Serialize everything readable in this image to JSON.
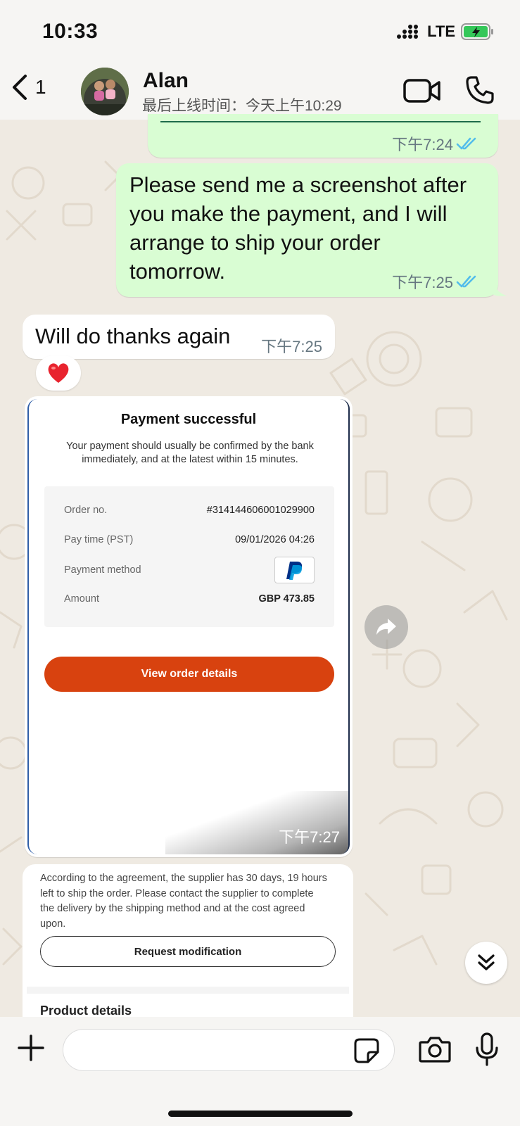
{
  "status_bar": {
    "time": "10:33",
    "network": "LTE"
  },
  "header": {
    "back_count": "1",
    "contact_name": "Alan",
    "last_seen": "最后上线时间：今天上午10:29"
  },
  "messages": [
    {
      "direction": "out",
      "time": "下午7:24",
      "read": true
    },
    {
      "direction": "out",
      "text": "Please send me a screenshot after you make the payment, and I will arrange to ship your order tomorrow.",
      "time": "下午7:25",
      "read": true
    },
    {
      "direction": "in",
      "text": "Will do thanks again",
      "time": "下午7:25",
      "reaction": "❤️"
    }
  ],
  "payment_card": {
    "title": "Payment successful",
    "description": "Your payment should usually be confirmed by the bank immediately, and at the latest within 15 minutes.",
    "rows": [
      {
        "label": "Order no.",
        "value": "#314144606001029900"
      },
      {
        "label": "Pay time (PST)",
        "value": "09/01/2026 04:26"
      },
      {
        "label": "Payment method",
        "value": ""
      },
      {
        "label": "Amount",
        "value": "GBP 473.85"
      }
    ],
    "button_label": "View order details",
    "time": "下午7:27"
  },
  "card2": {
    "text": "According to the agreement, the supplier has 30 days, 19 hours left to ship the order. Please contact the supplier to complete the delivery by the shipping method and at the cost agreed upon.",
    "button_label": "Request modification",
    "section_title": "Product details"
  },
  "colors": {
    "outgoing_bubble": "#d9fdd3",
    "incoming_bubble": "#ffffff",
    "read_ticks": "#53bdeb",
    "primary_button": "#d8420f",
    "chat_background": "#efeae2"
  },
  "icons": [
    "back-chevron-icon",
    "video-call-icon",
    "phone-call-icon",
    "double-check-icon",
    "forward-icon",
    "scroll-down-icon",
    "plus-icon",
    "sticker-icon",
    "camera-icon",
    "mic-icon",
    "paypal-icon"
  ]
}
